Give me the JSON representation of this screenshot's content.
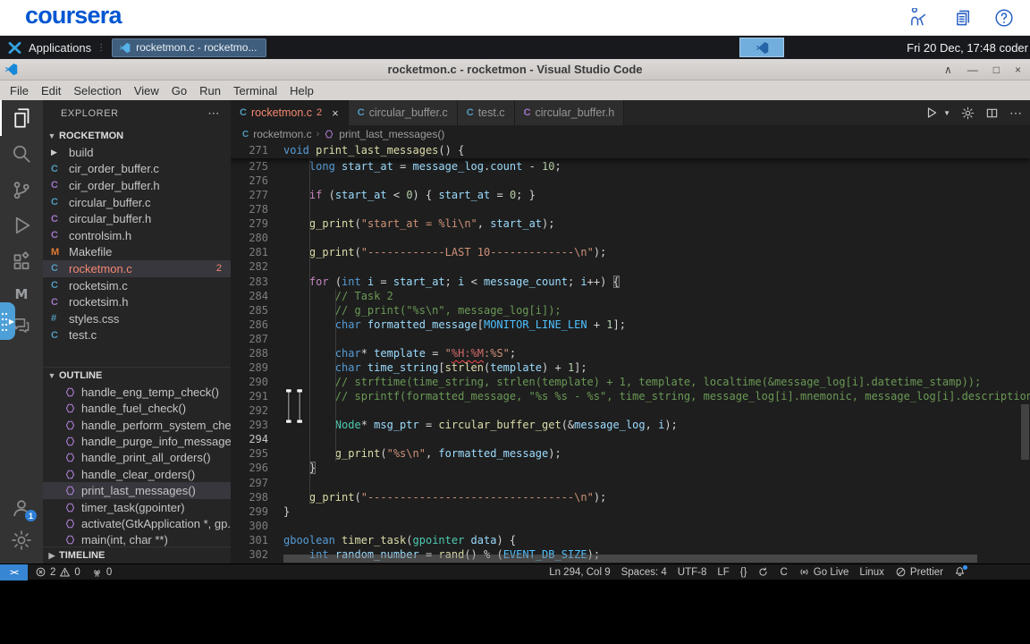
{
  "colors": {
    "coursera_blue": "#0056d2",
    "error_red": "#f48771",
    "selection_bg": "#37373d",
    "remote_blue": "#3686d3",
    "c_file_blue": "#519aba",
    "h_file_purple": "#a074c4",
    "makefile_orange": "#e37933"
  },
  "coursera": {
    "logo": "coursera",
    "icons": [
      "tutor",
      "lab-notes",
      "help"
    ]
  },
  "taskbar": {
    "applications_label": "Applications",
    "window_button_label": "rocketmon.c - rocketmo...",
    "clock": "Fri 20 Dec, 17:48 coder"
  },
  "titlebar": {
    "title": "rocketmon.c - rocketmon - Visual Studio Code",
    "controls": [
      "shade",
      "minimize",
      "maximize",
      "close"
    ]
  },
  "menubar": {
    "items": [
      "File",
      "Edit",
      "Selection",
      "View",
      "Go",
      "Run",
      "Terminal",
      "Help"
    ]
  },
  "activity_bar": {
    "items": [
      "explorer",
      "search",
      "source-control",
      "run-and-debug",
      "extensions"
    ],
    "extra_items": [
      "extension-m",
      "comments"
    ],
    "account_badge": "1"
  },
  "sidebar": {
    "title": "EXPLORER",
    "root": "ROCKETMON",
    "files": [
      {
        "name": "build",
        "icon": "chevron",
        "color": ""
      },
      {
        "name": "cir_order_buffer.c",
        "icon": "C",
        "color": "#519aba"
      },
      {
        "name": "cir_order_buffer.h",
        "icon": "C",
        "color": "#a074c4"
      },
      {
        "name": "circular_buffer.c",
        "icon": "C",
        "color": "#519aba"
      },
      {
        "name": "circular_buffer.h",
        "icon": "C",
        "color": "#a074c4"
      },
      {
        "name": "controlsim.h",
        "icon": "C",
        "color": "#a074c4"
      },
      {
        "name": "Makefile",
        "icon": "M",
        "color": "#e37933"
      },
      {
        "name": "rocketmon.c",
        "icon": "C",
        "color": "#519aba",
        "selected": true,
        "error": true,
        "badge": "2"
      },
      {
        "name": "rocketsim.c",
        "icon": "C",
        "color": "#519aba"
      },
      {
        "name": "rocketsim.h",
        "icon": "C",
        "color": "#a074c4"
      },
      {
        "name": "styles.css",
        "icon": "#",
        "color": "#519aba"
      },
      {
        "name": "test.c",
        "icon": "C",
        "color": "#519aba"
      }
    ],
    "outline_title": "OUTLINE",
    "outline": [
      {
        "name": "handle_eng_temp_check()"
      },
      {
        "name": "handle_fuel_check()"
      },
      {
        "name": "handle_perform_system_chec..."
      },
      {
        "name": "handle_purge_info_messages()"
      },
      {
        "name": "handle_print_all_orders()"
      },
      {
        "name": "handle_clear_orders()"
      },
      {
        "name": "print_last_messages()",
        "selected": true
      },
      {
        "name": "timer_task(gpointer)"
      },
      {
        "name": "activate(GtkApplication *, gp..."
      },
      {
        "name": "main(int, char **)"
      }
    ],
    "timeline_title": "TIMELINE"
  },
  "tabs": [
    {
      "label": "rocketmon.c",
      "badge": "2",
      "color": "#519aba",
      "active": true,
      "close": "×"
    },
    {
      "label": "circular_buffer.c",
      "color": "#519aba"
    },
    {
      "label": "test.c",
      "color": "#519aba"
    },
    {
      "label": "circular_buffer.h",
      "color": "#a074c4"
    }
  ],
  "breadcrumb": {
    "file": "rocketmon.c",
    "symbol": "print_last_messages()"
  },
  "editor": {
    "lines": [
      {
        "num": 271,
        "sticky": true,
        "segs": [
          [
            "kw",
            "void "
          ],
          [
            "fn",
            "print_last_messages"
          ],
          [
            "pun",
            "() {"
          ]
        ]
      },
      {
        "num": 275,
        "segs": [
          [
            "pln",
            "    "
          ],
          [
            "kw",
            "long "
          ],
          [
            "var",
            "start_at "
          ],
          [
            "pun",
            "= "
          ],
          [
            "var",
            "message_log"
          ],
          [
            "pun",
            "."
          ],
          [
            "var",
            "count "
          ],
          [
            "pun",
            "- "
          ],
          [
            "num",
            "10"
          ],
          [
            "pun",
            ";"
          ]
        ]
      },
      {
        "num": 276,
        "segs": []
      },
      {
        "num": 277,
        "segs": [
          [
            "pln",
            "    "
          ],
          [
            "ctrl",
            "if "
          ],
          [
            "pun",
            "("
          ],
          [
            "var",
            "start_at "
          ],
          [
            "pun",
            "< "
          ],
          [
            "num",
            "0"
          ],
          [
            "pun",
            ") { "
          ],
          [
            "var",
            "start_at "
          ],
          [
            "pun",
            "= "
          ],
          [
            "num",
            "0"
          ],
          [
            "pun",
            "; }"
          ]
        ]
      },
      {
        "num": 278,
        "segs": []
      },
      {
        "num": 279,
        "segs": [
          [
            "pln",
            "    "
          ],
          [
            "fn",
            "g_print"
          ],
          [
            "pun",
            "("
          ],
          [
            "str",
            "\"start_at = %li\\n\""
          ],
          [
            "pun",
            ", "
          ],
          [
            "var",
            "start_at"
          ],
          [
            "pun",
            ");"
          ]
        ]
      },
      {
        "num": 280,
        "segs": []
      },
      {
        "num": 281,
        "segs": [
          [
            "pln",
            "    "
          ],
          [
            "fn",
            "g_print"
          ],
          [
            "pun",
            "("
          ],
          [
            "str",
            "\"------------LAST 10-------------\\n\""
          ],
          [
            "pun",
            ");"
          ]
        ]
      },
      {
        "num": 282,
        "segs": []
      },
      {
        "num": 283,
        "segs": [
          [
            "pln",
            "    "
          ],
          [
            "ctrl",
            "for "
          ],
          [
            "pun",
            "("
          ],
          [
            "kw",
            "int "
          ],
          [
            "var",
            "i "
          ],
          [
            "pun",
            "= "
          ],
          [
            "var",
            "start_at"
          ],
          [
            "pun",
            "; "
          ],
          [
            "var",
            "i "
          ],
          [
            "pun",
            "< "
          ],
          [
            "var",
            "message_count"
          ],
          [
            "pun",
            "; "
          ],
          [
            "var",
            "i"
          ],
          [
            "pun",
            "++) "
          ],
          [
            "bm",
            "{"
          ]
        ]
      },
      {
        "num": 284,
        "segs": [
          [
            "pln",
            "        "
          ],
          [
            "com",
            "// Task 2"
          ]
        ]
      },
      {
        "num": 285,
        "segs": [
          [
            "pln",
            "        "
          ],
          [
            "com",
            "// g_print(\"%s\\n\", message_log[i]);"
          ]
        ]
      },
      {
        "num": 286,
        "segs": [
          [
            "pln",
            "        "
          ],
          [
            "kw",
            "char "
          ],
          [
            "var",
            "formatted_message"
          ],
          [
            "pun",
            "["
          ],
          [
            "mac",
            "MONITOR_LINE_LEN "
          ],
          [
            "pun",
            "+ "
          ],
          [
            "num",
            "1"
          ],
          [
            "pun",
            "];"
          ]
        ]
      },
      {
        "num": 287,
        "segs": []
      },
      {
        "num": 288,
        "segs": [
          [
            "pln",
            "        "
          ],
          [
            "kw",
            "char"
          ],
          [
            "pun",
            "* "
          ],
          [
            "var",
            "template "
          ],
          [
            "pun",
            "= "
          ],
          [
            "str",
            "\""
          ],
          [
            "strq",
            "%H:%M"
          ],
          [
            "str",
            ":%S\""
          ],
          [
            "pun",
            ";"
          ]
        ]
      },
      {
        "num": 289,
        "segs": [
          [
            "pln",
            "        "
          ],
          [
            "kw",
            "char "
          ],
          [
            "var",
            "time_string"
          ],
          [
            "pun",
            "["
          ],
          [
            "fn",
            "strlen"
          ],
          [
            "pun",
            "("
          ],
          [
            "var",
            "template"
          ],
          [
            "pun",
            ") + "
          ],
          [
            "num",
            "1"
          ],
          [
            "pun",
            "];"
          ]
        ]
      },
      {
        "num": 290,
        "segs": [
          [
            "pln",
            "        "
          ],
          [
            "com",
            "// strftime(time_string, strlen(template) + 1, template, localtime(&message_log[i].datetime_stamp));"
          ]
        ]
      },
      {
        "num": 291,
        "segs": [
          [
            "pln",
            "        "
          ],
          [
            "com",
            "// sprintf(formatted_message, \"%s %s - %s\", time_string, message_log[i].mnemonic, message_log[i].description"
          ]
        ]
      },
      {
        "num": 292,
        "segs": []
      },
      {
        "num": 293,
        "segs": [
          [
            "pln",
            "        "
          ],
          [
            "type",
            "Node"
          ],
          [
            "pun",
            "* "
          ],
          [
            "var",
            "msg_ptr "
          ],
          [
            "pun",
            "= "
          ],
          [
            "fn",
            "circular_buffer_get"
          ],
          [
            "pun",
            "(&"
          ],
          [
            "var",
            "message_log"
          ],
          [
            "pun",
            ", "
          ],
          [
            "var",
            "i"
          ],
          [
            "pun",
            ");"
          ]
        ]
      },
      {
        "num": 294,
        "caret": true,
        "segs": [
          [
            "pln",
            "        "
          ]
        ]
      },
      {
        "num": 295,
        "segs": [
          [
            "pln",
            "        "
          ],
          [
            "fn",
            "g_print"
          ],
          [
            "pun",
            "("
          ],
          [
            "str",
            "\"%s\\n\""
          ],
          [
            "pun",
            ", "
          ],
          [
            "var",
            "formatted_message"
          ],
          [
            "pun",
            ");"
          ]
        ]
      },
      {
        "num": 296,
        "segs": [
          [
            "pln",
            "    "
          ],
          [
            "bm",
            "}"
          ]
        ]
      },
      {
        "num": 297,
        "segs": []
      },
      {
        "num": 298,
        "segs": [
          [
            "pln",
            "    "
          ],
          [
            "fn",
            "g_print"
          ],
          [
            "pun",
            "("
          ],
          [
            "str",
            "\"--------------------------------\\n\""
          ],
          [
            "pun",
            ");"
          ]
        ]
      },
      {
        "num": 299,
        "segs": [
          [
            "pun",
            "}"
          ]
        ]
      },
      {
        "num": 300,
        "segs": []
      },
      {
        "num": 301,
        "segs": [
          [
            "kw",
            "gboolean "
          ],
          [
            "fn",
            "timer_task"
          ],
          [
            "pun",
            "("
          ],
          [
            "type",
            "gpointer "
          ],
          [
            "var",
            "data"
          ],
          [
            "pun",
            ") {"
          ]
        ]
      },
      {
        "num": 302,
        "segs": [
          [
            "pln",
            "    "
          ],
          [
            "kw",
            "int "
          ],
          [
            "var",
            "random_number "
          ],
          [
            "pun",
            "= "
          ],
          [
            "fn",
            "rand"
          ],
          [
            "pun",
            "() % ("
          ],
          [
            "mac",
            "EVENT_DB_SIZE"
          ],
          [
            "pun",
            ");"
          ]
        ]
      }
    ]
  },
  "status_bar": {
    "remote_glyph": "><",
    "errors": "2",
    "warnings": "0",
    "ports": "0",
    "right": [
      {
        "name": "cursor-position",
        "label": "Ln 294, Col 9"
      },
      {
        "name": "indentation",
        "label": "Spaces: 4"
      },
      {
        "name": "encoding",
        "label": "UTF-8"
      },
      {
        "name": "eol",
        "label": "LF"
      },
      {
        "name": "braces",
        "label": "{}"
      },
      {
        "name": "sync",
        "icon": "sync"
      },
      {
        "name": "language-mode",
        "label": "C"
      },
      {
        "name": "go-live",
        "icon": "broadcast",
        "label": "Go Live"
      },
      {
        "name": "os",
        "label": "Linux"
      },
      {
        "name": "prettier",
        "icon": "slash",
        "label": "Prettier"
      },
      {
        "name": "notifications",
        "icon": "bell",
        "dot": true
      }
    ]
  }
}
